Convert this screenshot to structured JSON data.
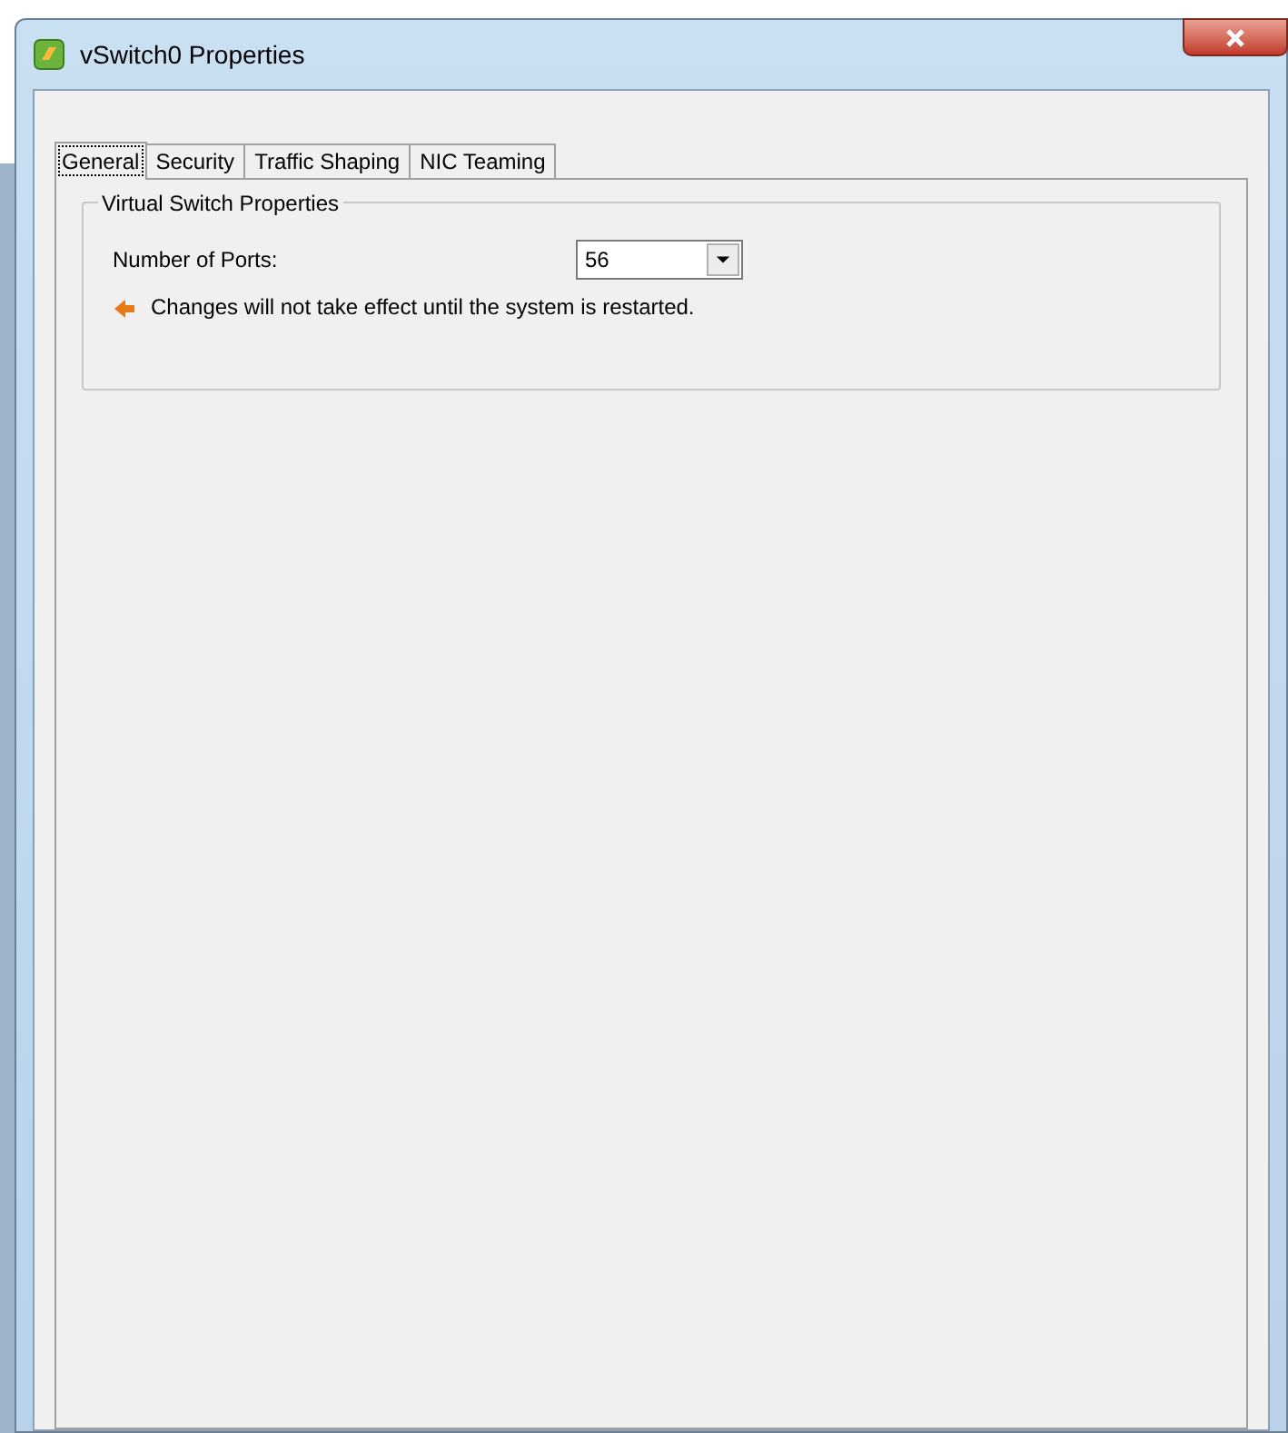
{
  "window": {
    "title": "vSwitch0 Properties"
  },
  "tabs": [
    {
      "label": "General",
      "selected": true
    },
    {
      "label": "Security",
      "selected": false
    },
    {
      "label": "Traffic Shaping",
      "selected": false
    },
    {
      "label": "NIC Teaming",
      "selected": false
    }
  ],
  "group": {
    "title": "Virtual Switch Properties",
    "ports_label": "Number of Ports:",
    "ports_value": "56",
    "note": "Changes will not take effect until the system is restarted."
  }
}
